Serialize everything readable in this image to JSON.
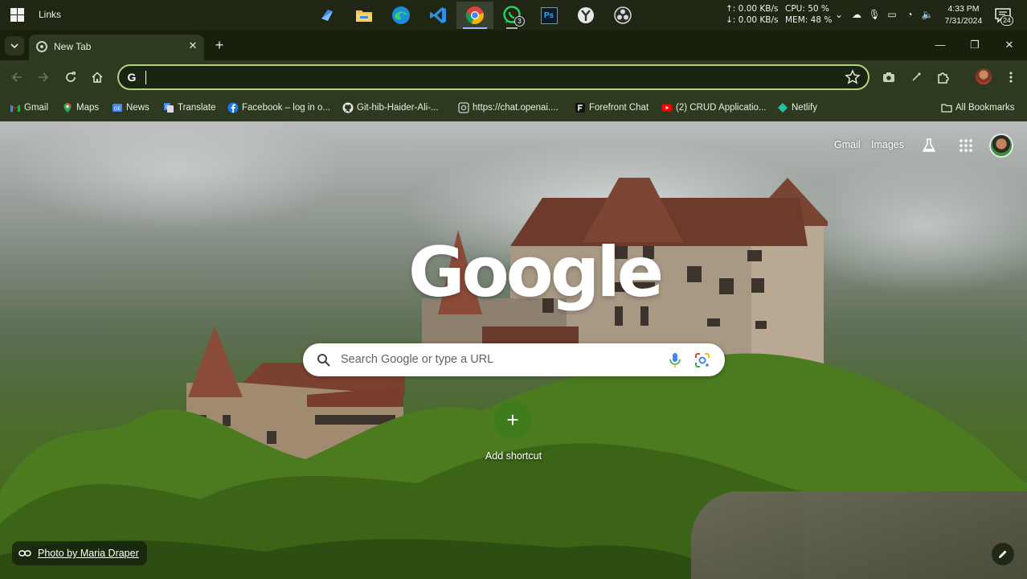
{
  "taskbar": {
    "label": "Links",
    "apps": [
      {
        "name": "file-sharing",
        "icon": "share-icon"
      },
      {
        "name": "file-explorer",
        "icon": "folder-icon"
      },
      {
        "name": "edge",
        "icon": "edge-icon"
      },
      {
        "name": "vscode",
        "icon": "vscode-icon"
      },
      {
        "name": "chrome",
        "icon": "chrome-icon"
      },
      {
        "name": "whatsapp",
        "icon": "whatsapp-icon",
        "badge": "3"
      },
      {
        "name": "photoshop",
        "icon": "photoshop-icon",
        "text": "Ps"
      },
      {
        "name": "app-y",
        "icon": "y-app-icon"
      },
      {
        "name": "obs",
        "icon": "obs-icon"
      }
    ],
    "net_up": "↑: 0.00 KB/s",
    "net_down": "↓: 0.00 KB/s",
    "cpu": "CPU: 50 %",
    "mem": "MEM: 48 %",
    "time": "4:33 PM",
    "date": "7/31/2024",
    "notifications": "24"
  },
  "browser": {
    "tab_title": "New Tab",
    "omnibox": {
      "value": "",
      "placeholder": ""
    },
    "bookmarks": [
      {
        "label": "Gmail",
        "icon": "gmail-icon",
        "color": "#ea4335"
      },
      {
        "label": "Maps",
        "icon": "maps-icon",
        "color": "#34a853"
      },
      {
        "label": "News",
        "icon": "news-icon",
        "color": "#4285f4"
      },
      {
        "label": "Translate",
        "icon": "translate-icon",
        "color": "#4285f4"
      },
      {
        "label": "Facebook – log in o...",
        "icon": "facebook-icon",
        "color": "#1877f2"
      },
      {
        "label": "Git-hib-Haider-Ali-...",
        "icon": "github-icon",
        "color": "#e8e8e8"
      },
      {
        "label": "https://chat.openai....",
        "icon": "openai-icon",
        "color": "#cccccc"
      },
      {
        "label": "Forefront Chat",
        "icon": "forefront-icon",
        "color": "#111111"
      },
      {
        "label": "(2) CRUD Applicatio...",
        "icon": "youtube-icon",
        "color": "#ff0000"
      },
      {
        "label": "Netlify",
        "icon": "netlify-icon",
        "color": "#25c2a0"
      }
    ],
    "all_bookmarks": "All Bookmarks"
  },
  "ntp": {
    "gmail_link": "Gmail",
    "images_link": "Images",
    "logo": "Google",
    "search_placeholder": "Search Google or type a URL",
    "add_shortcut": "Add shortcut",
    "attribution": "Photo by Maria Draper"
  },
  "colors": {
    "omnibox_border": "#b4d47c",
    "chrome_frame": "#2d3a20",
    "shortcut_button": "#3d7b1d"
  }
}
